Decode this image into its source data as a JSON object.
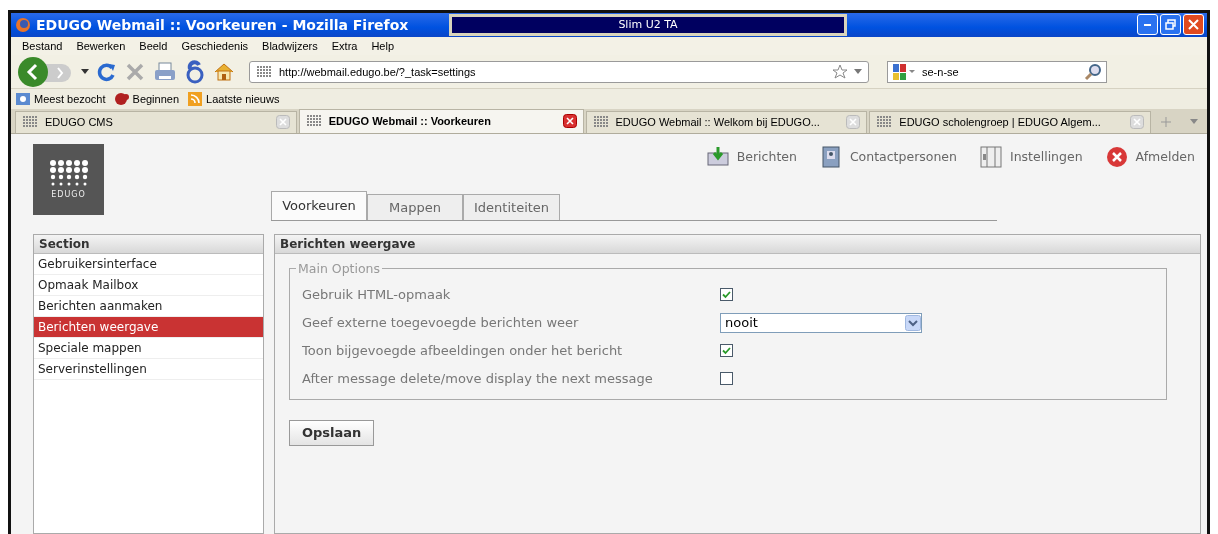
{
  "window": {
    "title": "EDUGO Webmail :: Voorkeuren - Mozilla Firefox",
    "overlay_title": "Slim U2 TA"
  },
  "menu": [
    "Bestand",
    "Bewerken",
    "Beeld",
    "Geschiedenis",
    "Bladwijzers",
    "Extra",
    "Help"
  ],
  "address": {
    "value": "http://webmail.edugo.be/?_task=settings"
  },
  "search": {
    "value": "se-n-se"
  },
  "bookmarks": [
    "Meest bezocht",
    "Beginnen",
    "Laatste nieuws"
  ],
  "browser_tabs": [
    {
      "label": "EDUGO CMS",
      "selected": false
    },
    {
      "label": "EDUGO Webmail :: Voorkeuren",
      "selected": true
    },
    {
      "label": "EDUGO Webmail :: Welkom bij EDUGO...",
      "selected": false
    },
    {
      "label": "EDUGO scholengroep | EDUGO Algem...",
      "selected": false
    }
  ],
  "logo": {
    "text": "EDUGO"
  },
  "top_nav": [
    {
      "label": "Berichten",
      "kind": "mail"
    },
    {
      "label": "Contactpersonen",
      "kind": "contacts"
    },
    {
      "label": "Instellingen",
      "kind": "settings"
    },
    {
      "label": "Afmelden",
      "kind": "logout"
    }
  ],
  "settings_tabs": [
    {
      "label": "Voorkeuren",
      "selected": true
    },
    {
      "label": "Mappen",
      "selected": false
    },
    {
      "label": "Identiteiten",
      "selected": false
    }
  ],
  "sections": {
    "title": "Section",
    "items": [
      {
        "label": "Gebruikersinterface",
        "selected": false
      },
      {
        "label": "Opmaak Mailbox",
        "selected": false
      },
      {
        "label": "Berichten aanmaken",
        "selected": false
      },
      {
        "label": "Berichten weergave",
        "selected": true
      },
      {
        "label": "Speciale mappen",
        "selected": false
      },
      {
        "label": "Serverinstellingen",
        "selected": false
      }
    ]
  },
  "panel": {
    "title": "Berichten weergave",
    "group": "Main Options",
    "options": [
      {
        "label": "Gebruik HTML-opmaak",
        "kind": "checkbox",
        "checked": true
      },
      {
        "label": "Geef externe toegevoegde berichten weer",
        "kind": "select",
        "value": "nooit"
      },
      {
        "label": "Toon bijgevoegde afbeeldingen onder het bericht",
        "kind": "checkbox",
        "checked": true
      },
      {
        "label": "After message delete/move display the next message",
        "kind": "checkbox",
        "checked": false
      }
    ],
    "save": "Opslaan"
  }
}
